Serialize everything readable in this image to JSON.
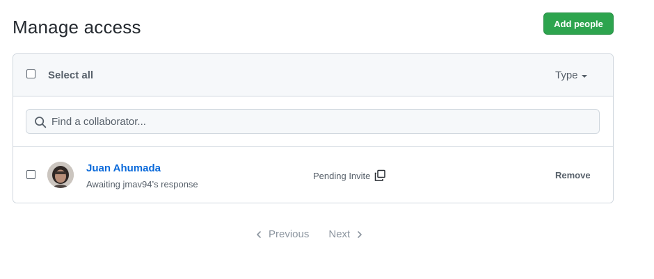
{
  "page": {
    "title": "Manage access",
    "add_button_label": "Add people"
  },
  "header": {
    "select_all_label": "Select all",
    "type_filter_label": "Type"
  },
  "search": {
    "placeholder": "Find a collaborator...",
    "value": ""
  },
  "members": [
    {
      "name": "Juan Ahumada",
      "subtitle": "Awaiting jmav94’s response",
      "status": "Pending Invite",
      "action_label": "Remove",
      "avatar": "user-photo"
    }
  ],
  "pagination": {
    "previous_label": "Previous",
    "next_label": "Next"
  },
  "colors": {
    "accent": "#2da44e",
    "link": "#0969da",
    "muted": "#57606a",
    "border": "#d0d7de",
    "header_bg": "#f6f8fa"
  },
  "icons": [
    "search-icon",
    "copy-icon",
    "caret-down-icon",
    "chevron-left-icon",
    "chevron-right-icon"
  ]
}
